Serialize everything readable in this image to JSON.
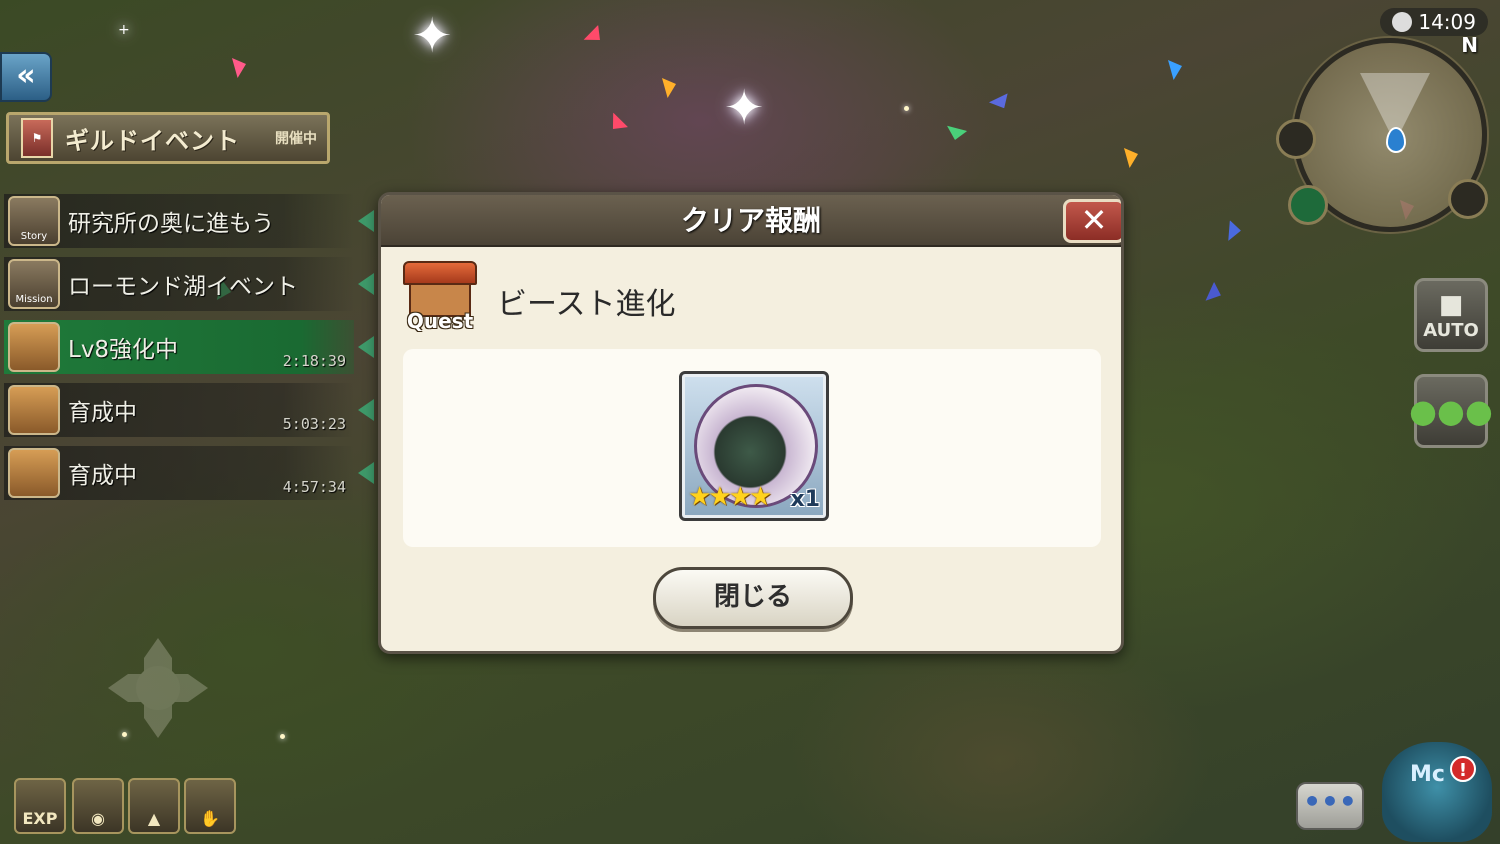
{
  "status_bar": {
    "time": "14:09"
  },
  "left_panel": {
    "guild_event": {
      "label": "ギルドイベント",
      "status": "開催中"
    },
    "quests": [
      {
        "icon_text": "Story",
        "label": "研究所の奥に進もう",
        "time": ""
      },
      {
        "icon_text": "Mission",
        "label": "ローモンド湖イベント",
        "time": ""
      },
      {
        "icon_text": "",
        "label": "Lv8強化中",
        "time": "2:18:39"
      },
      {
        "icon_text": "",
        "label": "育成中",
        "time": "5:03:23"
      },
      {
        "icon_text": "",
        "label": "育成中",
        "time": "4:57:34"
      }
    ]
  },
  "bottom_bar": {
    "exp_label": "EXP"
  },
  "right_panel": {
    "minimap_north": "N",
    "auto_label": "AUTO",
    "chat_label": "•••",
    "mascot_label": "Mc",
    "mascot_badge": "!"
  },
  "modal": {
    "title": "クリア報酬",
    "close_icon": "✕",
    "quest_icon_label": "Quest",
    "quest_name": "ビースト進化",
    "reward": {
      "stars": "★★★★",
      "quantity": "x1"
    },
    "close_button_label": "閉じる"
  },
  "colors": {
    "accent_green": "#1f7a3a",
    "modal_bg": "#f4efdf",
    "close_red": "#c2584c",
    "star_gold": "#ffd21e"
  }
}
